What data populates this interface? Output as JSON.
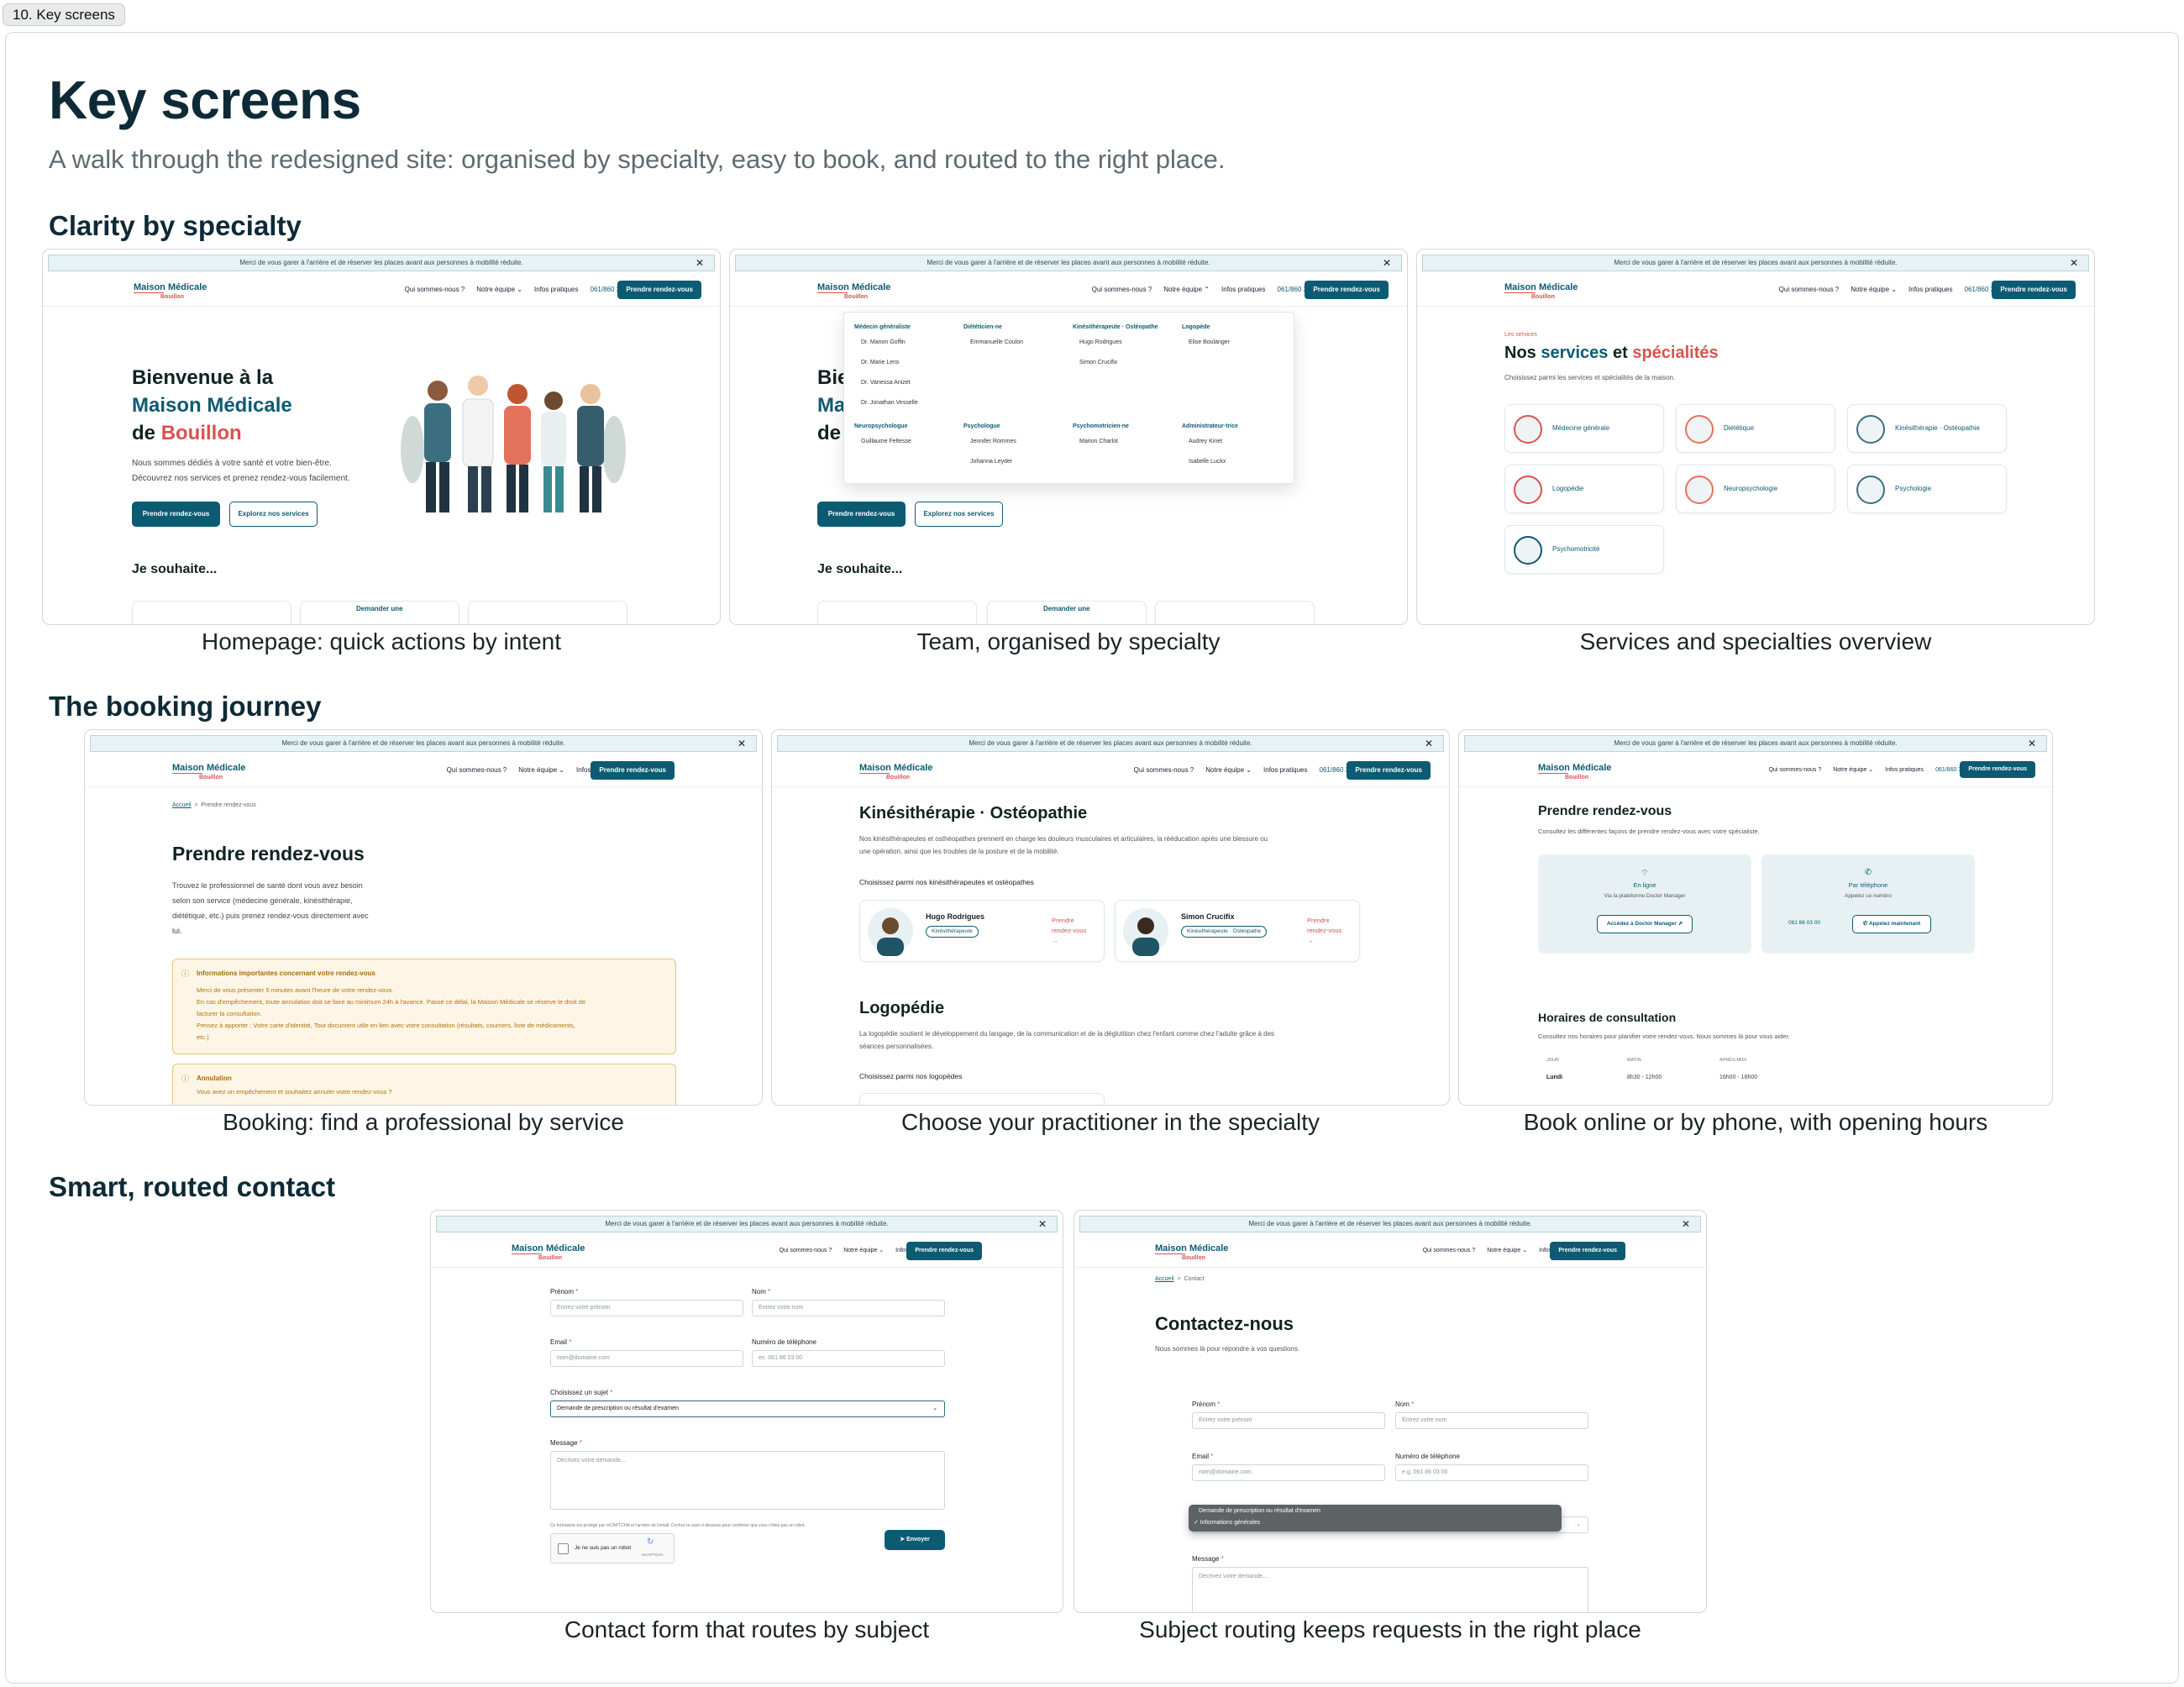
{
  "frame_tag": "10. Key screens",
  "title": "Key screens",
  "subtitle": "A walk through the redesigned site: organised by specialty, easy to book, and routed to the right place.",
  "sections": {
    "s1": "Clarity by specialty",
    "s2": "The booking journey",
    "s3": "Smart, routed contact"
  },
  "captions": {
    "home": "Homepage: quick actions by intent",
    "team": "Team, organised by specialty",
    "services": "Services and specialties overview",
    "booking": "Booking: find a professional by service",
    "practitioner": "Choose your practitioner in the specialty",
    "online": "Book online or by phone, with opening hours",
    "contact_form": "Contact form that routes by subject",
    "routing": "Subject routing keeps requests in the right place"
  },
  "site": {
    "banner": "Merci de vous garer à l'arrière et de réserver les places avant aux personnes à mobilité réduite.",
    "close": "✕",
    "logo_main": "Maison Médicale",
    "logo_sub": "Bouillon",
    "nav": {
      "about": "Qui sommes-nous ?",
      "team": "Notre équipe",
      "info": "Infos pratiques",
      "phone": "061/860 300",
      "cta": "Prendre rendez-vous"
    }
  },
  "home": {
    "h_line1": "Bienvenue à la",
    "h_line2": "Maison Médicale",
    "h_line3a": "de ",
    "h_line3b": "Bouillon",
    "p1": "Nous sommes dédiés à votre santé et votre bien-être.",
    "p2": "Découvrez nos services et prenez rendez-vous facilement.",
    "btn_primary": "Prendre rendez-vous",
    "btn_secondary": "Explorez nos services",
    "wish": "Je souhaite...",
    "card_label": "Demander une"
  },
  "team_menu": {
    "cols": [
      {
        "head": "Médecin généraliste",
        "items": [
          "Dr. Manon Goffin",
          "Dr. Marie Lens",
          "Dr. Vanessa Anizet",
          "Dr. Jonathan Vesselle"
        ]
      },
      {
        "head": "Diététicien·ne",
        "items": [
          "Emmanuelle Coulon"
        ]
      },
      {
        "head": "Kinésithérapeute · Ostéopathe",
        "items": [
          "Hugo Rodrigues",
          "Simon Crucifix"
        ]
      },
      {
        "head": "Logopède",
        "items": [
          "Elise Boulanger"
        ]
      },
      {
        "head": "Neuropsychologue",
        "items": [
          "Guillaume Feltesse"
        ]
      },
      {
        "head": "Psychologue",
        "items": [
          "Jennifer Rommes",
          "Johanna Leyder"
        ]
      },
      {
        "head": "Psychomotricien·ne",
        "items": [
          "Marion Charlot"
        ]
      },
      {
        "head": "Administrateur·trice",
        "items": [
          "Audrey Kinet",
          "Isabelle Luckx"
        ]
      }
    ]
  },
  "services": {
    "eyebrow": "Les services",
    "title_a": "Nos ",
    "title_b": "services",
    "title_c": " et ",
    "title_d": "spécialités",
    "subtitle": "Choisissez parmi les services et spécialités de la maison.",
    "items": [
      "Médecine générale",
      "Diététique",
      "Kinésithérapie · Ostéopathie",
      "Logopédie",
      "Neuropsychologie",
      "Psychologie",
      "Psychomotricité"
    ]
  },
  "booking": {
    "crumb_home": "Accueil",
    "crumb_sep": ">",
    "crumb_page": "Prendre rendez-vous",
    "title": "Prendre rendez-vous",
    "p1": "Trouvez le professionnel de santé dont vous avez besoin",
    "p2": "selon son service (médecine générale, kinésithérapie,",
    "p3": "diététique, etc.) puis prenez rendez-vous directement avec",
    "p4": "lui.",
    "notice_title": "Informations importantes concernant votre rendez-vous",
    "notice_l1": "Merci de vous présenter 5 minutes avant l'heure de votre rendez-vous.",
    "notice_l2": "En cas d'empêchement, toute annulation doit se faire au minimum 24h à l'avance. Passé ce délai, la Maison Médicale se réserve le droit de",
    "notice_l3": "facturer la consultation.",
    "notice_l4": "Pensez à apporter : Votre carte d'identité, Tout document utile en lien avec votre consultation (résultats, courriers, liste de médicaments,",
    "notice_l5": "etc.)",
    "cancel_title": "Annulation",
    "cancel_l1": "Vous avez un empêchement et souhaitez annuler votre rendez-vous ?"
  },
  "practitioner": {
    "title": "Kinésithérapie · Ostéopathie",
    "p1": "Nos kinésithérapeutes et osthéopathes prennent en charge les douleurs musculaires et articulaires, la rééducation après une blessure ou",
    "p2": "une opération, ainsi que les troubles de la posture et de la mobilité.",
    "choose": "Choisissez parmi nos kinésithérapeutes et ostéopathes",
    "people": [
      {
        "name": "Hugo Rodrigues",
        "tag": "Kinésithérapeute",
        "cta1": "Prendre",
        "cta2": "rendez-vous"
      },
      {
        "name": "Simon Crucifix",
        "tag": "Kinésithérapeute · Ostéopathe",
        "cta1": "Prendre",
        "cta2": "rendez-vous"
      }
    ],
    "arrow": "→",
    "title2": "Logopédie",
    "q1": "La logopédie soutient le développement du langage, de la communication et de la déglutition chez l'enfant comme chez l'adulte grâce à des",
    "q2": "séances personnalisées.",
    "choose2": "Choisissez parmi nos logopèdes"
  },
  "online": {
    "title": "Prendre rendez-vous",
    "subtitle": "Consultez les différentes façons de prendre rendez-vous avec votre spécialiste.",
    "online_title": "En ligne",
    "online_sub": "Via la plateforme Doctor Manager",
    "online_btn": "Accédez à Doctor Manager",
    "phone_title": "Par téléphone",
    "phone_sub": "Appelez ce numéro",
    "phone_num": "061 86 03 00",
    "phone_btn": "Appelez maintenant",
    "hours_title": "Horaires de consultation",
    "hours_sub": "Consultez nos horaires pour planifier votre rendez-vous. Nous sommes là pour vous aider.",
    "col_day": "JOUR",
    "col_am": "MATIN",
    "col_pm": "APRÈS-MIDI",
    "row_day": "Lundi",
    "row_am": "8h30 - 12h00",
    "row_pm": "16h00 - 18h00"
  },
  "form": {
    "first": "Prénom",
    "first_ph": "Entrez votre prénom",
    "last": "Nom",
    "last_ph": "Entrez votre nom",
    "email": "Email",
    "email_ph": "nom@domaine.com",
    "phone": "Numéro de téléphone",
    "phone_ph": "ex. 061 86 03 00",
    "phone_ph2": "e.g. 061 86 03 00",
    "subject": "Choisissez un sujet",
    "subject_val": "Demande de prescription ou résultat d'examen",
    "message": "Message",
    "message_ph": "Décrivez votre demande...",
    "recaptcha_note": "Ce formulaire est protégé par reCAPTCHA et l'arrivée de l'email. Cochez la case ci-dessous pour confirmer que vous n'êtes pas un robot.",
    "robot": "Je ne suis pas un robot",
    "recaptcha": "reCAPTCHA",
    "send": "Envoyer",
    "req": "*"
  },
  "contact": {
    "crumb_home": "Accueil",
    "crumb_sep": ">",
    "crumb_page": "Contact",
    "title": "Contactez-nous",
    "subtitle": "Nous sommes là pour répondre à vos questions.",
    "menu_opt1": "Demande de prescription ou résultat d'examen",
    "menu_opt2": "✓ Informations générales"
  },
  "colors": {
    "teal": "#0c5b73",
    "coral": "#d9534f",
    "amber": "#c98a12"
  }
}
